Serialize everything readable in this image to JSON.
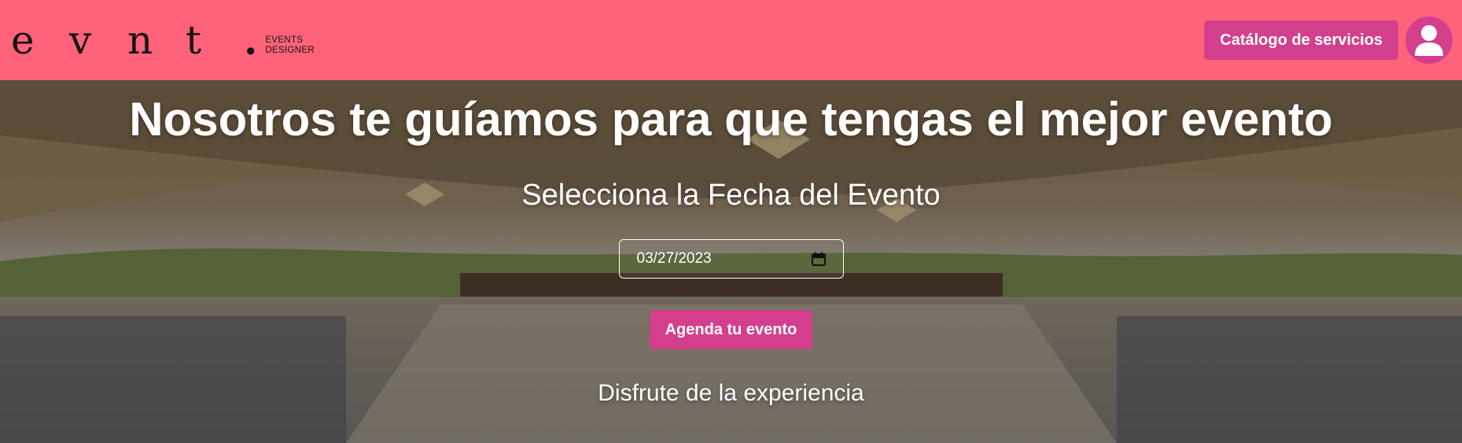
{
  "navbar": {
    "logo": {
      "letters": [
        "e",
        "v",
        "n",
        "t"
      ],
      "dot": ".",
      "subtitle_line1": "EVENTS",
      "subtitle_line2": "DESIGNER"
    },
    "catalog_label": "Catálogo de servicios",
    "avatar_icon": "user-avatar-icon",
    "color": "#ff6379"
  },
  "hero": {
    "title": "Nosotros te guíamos para que tengas el mejor evento",
    "subtitle": "Selecciona la Fecha del Evento",
    "date_value": "03/27/2023",
    "calendar_icon": "calendar-icon",
    "cta_label": "Agenda tu evento",
    "footer_text": "Disfrute de la experiencia",
    "accent_color": "#d43f8d"
  }
}
